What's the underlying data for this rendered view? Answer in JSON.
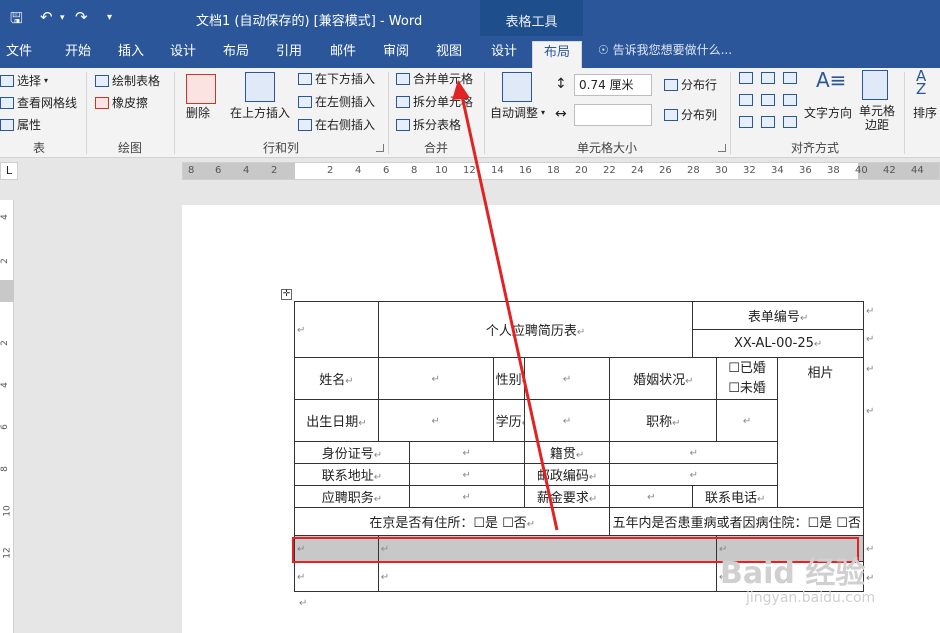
{
  "window": {
    "title": "文档1 (自动保存的) [兼容模式] - Word",
    "contextual_group": "表格工具"
  },
  "tabs": [
    "文件",
    "开始",
    "插入",
    "设计",
    "布局",
    "引用",
    "邮件",
    "审阅",
    "视图",
    "设计",
    "布局"
  ],
  "tell_me": "告诉我您想要做什么...",
  "ribbon": {
    "table_group": {
      "label": "表",
      "select": "选择",
      "gridlines": "查看网格线",
      "properties": "属性"
    },
    "draw_group": {
      "label": "绘图",
      "draw_table": "绘制表格",
      "eraser": "橡皮擦"
    },
    "rows_cols_group": {
      "label": "行和列",
      "delete": "删除",
      "insert_above": "在上方插入",
      "insert_below": "在下方插入",
      "insert_left": "在左侧插入",
      "insert_right": "在右侧插入"
    },
    "merge_group": {
      "label": "合并",
      "merge_cells": "合并单元格",
      "split_cells": "拆分单元格",
      "split_table": "拆分表格"
    },
    "cell_size_group": {
      "label": "单元格大小",
      "autofit": "自动调整",
      "height_value": "0.74 厘米",
      "width_value": "",
      "distribute_rows": "分布行",
      "distribute_cols": "分布列"
    },
    "align_group": {
      "label": "对齐方式",
      "text_direction": "文字方向",
      "cell_margins": "单元格边距",
      "sort": "排序"
    }
  },
  "ruler": {
    "h_ticks_left": [
      "8",
      "6",
      "4",
      "2"
    ],
    "h_ticks_right": [
      "2",
      "4",
      "6",
      "8",
      "10",
      "12",
      "14",
      "16",
      "18",
      "20",
      "22",
      "24",
      "26",
      "28",
      "30",
      "32",
      "34",
      "36",
      "38",
      "40",
      "42",
      "44"
    ],
    "v_ticks": [
      "4",
      "2",
      "2",
      "4",
      "6",
      "8",
      "10",
      "12"
    ]
  },
  "table": {
    "title": "个人应聘简历表",
    "form_no_label": "表单编号",
    "form_no_value": "XX-AL-00-25",
    "name": "姓名",
    "gender": "性别",
    "marital": "婚姻状况",
    "married": "☐已婚",
    "unmarried": "☐未婚",
    "photo": "相片",
    "birth": "出生日期",
    "education": "学历",
    "title_rank": "职称",
    "id_no": "身份证号",
    "native": "籍贯",
    "address": "联系地址",
    "zip": "邮政编码",
    "position": "应聘职务",
    "salary": "薪金要求",
    "phone": "联系电话",
    "beijing_housing": "在京是否有住所：☐是  ☐否",
    "hospital": "五年内是否患重病或者因病住院：☐是  ☐否",
    "cell_mark": "↵"
  },
  "watermark": {
    "main": "Baid 经验",
    "sub": "jingyan.baidu.com"
  }
}
